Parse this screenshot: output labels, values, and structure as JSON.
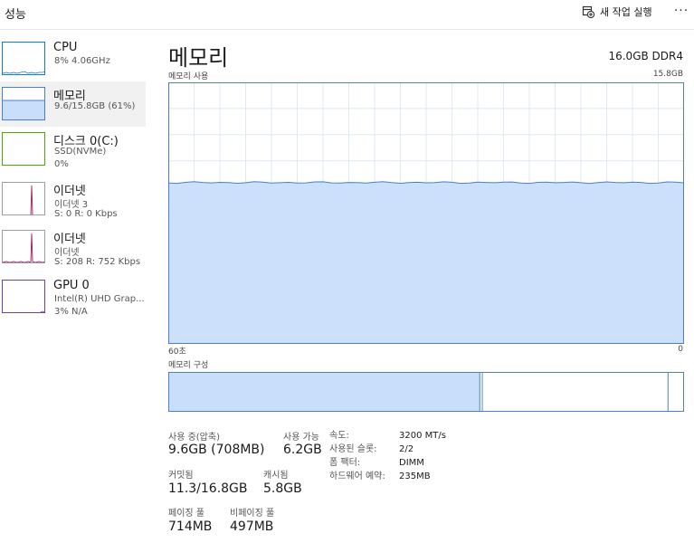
{
  "header": {
    "title": "성능",
    "run_task_label": "새 작업 실행",
    "more_label": "···"
  },
  "sidebar": {
    "items": [
      {
        "name": "CPU",
        "sub1": "8% 4.06GHz",
        "sub2": ""
      },
      {
        "name": "메모리",
        "sub1": "9.6/15.8GB (61%)",
        "sub2": ""
      },
      {
        "name": "디스크 0(C:)",
        "sub1": "SSD(NVMe)",
        "sub2": "0%"
      },
      {
        "name": "이더넷",
        "sub1": "이더넷 3",
        "sub2": "S: 0 R: 0 Kbps"
      },
      {
        "name": "이더넷",
        "sub1": "이더넷",
        "sub2": "S: 208 R: 752 Kbps"
      },
      {
        "name": "GPU 0",
        "sub1": "Intel(R) UHD Grap...",
        "sub2": "3% N/A"
      }
    ],
    "selected_index": 1
  },
  "main": {
    "title": "메모리",
    "spec": "16.0GB DDR4",
    "graph_label": "메모리 사용",
    "graph_max": "15.8GB",
    "axis_left": "60초",
    "axis_right": "0",
    "composition_label": "메모리 구성",
    "composition_in_use_fraction": 0.61,
    "composition_modified_fraction": 0.005,
    "composition_standby_fraction": 0.36,
    "usage_fraction": 0.61
  },
  "stats": {
    "in_use_label": "사용 중(압축)",
    "in_use_value": "9.6GB (708MB)",
    "available_label": "사용 가능",
    "available_value": "6.2GB",
    "committed_label": "커밋됨",
    "committed_value": "11.3/16.8GB",
    "cached_label": "캐시됨",
    "cached_value": "5.8GB",
    "paged_label": "페이징 풀",
    "paged_value": "714MB",
    "nonpaged_label": "비페이징 풀",
    "nonpaged_value": "497MB"
  },
  "info": {
    "speed_label": "속도:",
    "speed_value": "3200 MT/s",
    "slots_label": "사용된 슬롯:",
    "slots_value": "2/2",
    "form_label": "폼 팩터:",
    "form_value": "DIMM",
    "reserved_label": "하드웨어 예약:",
    "reserved_value": "235MB"
  },
  "colors": {
    "memory_line": "#4a80c8",
    "memory_fill": "#c9defb",
    "network_line": "#a3185c",
    "cpu_line": "#117dbb",
    "disk_line": "#4da60c",
    "gpu_line": "#6a3fb5",
    "grid": "#dfe8f4"
  }
}
